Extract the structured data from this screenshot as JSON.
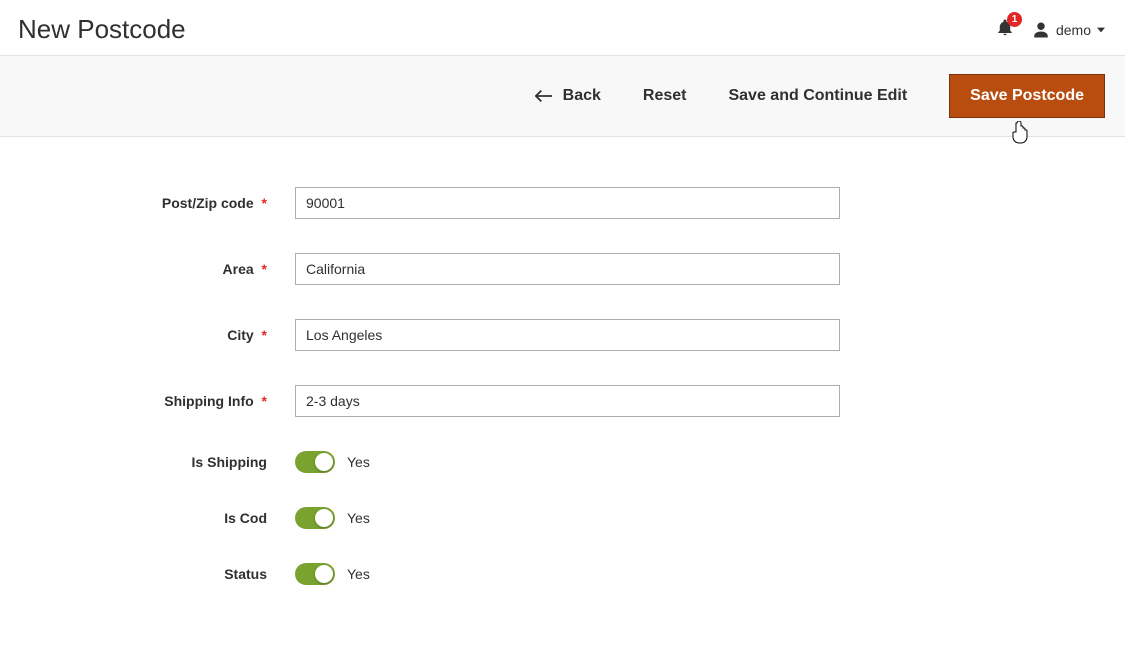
{
  "header": {
    "title": "New Postcode",
    "notification_count": "1",
    "username": "demo"
  },
  "toolbar": {
    "back_label": "Back",
    "reset_label": "Reset",
    "save_continue_label": "Save and Continue Edit",
    "save_label": "Save Postcode"
  },
  "form": {
    "postcode": {
      "label": "Post/Zip code",
      "value": "90001"
    },
    "area": {
      "label": "Area",
      "value": "California"
    },
    "city": {
      "label": "City",
      "value": "Los Angeles"
    },
    "shipping_info": {
      "label": "Shipping Info",
      "value": "2-3 days"
    },
    "is_shipping": {
      "label": "Is Shipping",
      "text": "Yes"
    },
    "is_cod": {
      "label": "Is Cod",
      "text": "Yes"
    },
    "status": {
      "label": "Status",
      "text": "Yes"
    }
  }
}
